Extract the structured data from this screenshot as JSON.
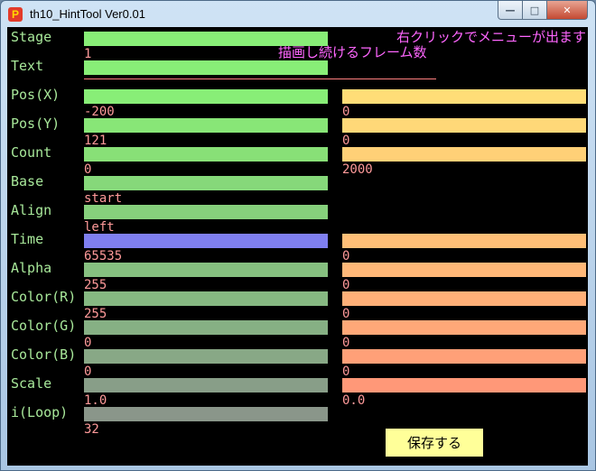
{
  "window": {
    "title": "th10_HintTool Ver0.01",
    "app_icon_letter": "P",
    "background_texts": [
      "",
      ""
    ]
  },
  "colors": {
    "label": "#a8e89a",
    "value": "#ff9a9a",
    "hint": "#ff66ff",
    "save_button_bg": "#ffff99"
  },
  "hint": {
    "line1": "右クリックでメニューが出ます",
    "line2": "描画し続けるフレーム数"
  },
  "rows": [
    {
      "label": "Stage",
      "left_value": "1",
      "right_value": "",
      "left_color": "#88ee77",
      "right_color": ""
    },
    {
      "label": "Text",
      "left_value": "",
      "right_value": "",
      "left_color": "#88ee77",
      "right_color": ""
    },
    {
      "label": "Pos(X)",
      "left_value": "-200",
      "right_value": "0",
      "left_color": "#88ee77",
      "right_color": "#ffdd77"
    },
    {
      "label": "Pos(Y)",
      "left_value": "121",
      "right_value": "0",
      "left_color": "#88e677",
      "right_color": "#ffd878"
    },
    {
      "label": "Count",
      "left_value": "0",
      "right_value": "2000",
      "left_color": "#88e077",
      "right_color": "#ffd077"
    },
    {
      "label": "Base",
      "left_value": "start",
      "right_value": "",
      "left_color": "#86d87a",
      "right_color": ""
    },
    {
      "label": "Align",
      "left_value": "left",
      "right_value": "",
      "left_color": "#86d07c",
      "right_color": ""
    },
    {
      "label": "Time",
      "left_value": "65535",
      "right_value": "0",
      "left_color": "#7f7ff0",
      "right_color": "#ffbf77"
    },
    {
      "label": "Alpha",
      "left_value": "255",
      "right_value": "0",
      "left_color": "#86c080",
      "right_color": "#ffb878"
    },
    {
      "label": "Color(R)",
      "left_value": "255",
      "right_value": "0",
      "left_color": "#86b882",
      "right_color": "#ffb078"
    },
    {
      "label": "Color(G)",
      "left_value": "0",
      "right_value": "0",
      "left_color": "#86b084",
      "right_color": "#ffa878"
    },
    {
      "label": "Color(B)",
      "left_value": "0",
      "right_value": "0",
      "left_color": "#88a886",
      "right_color": "#ffa078"
    },
    {
      "label": "Scale",
      "left_value": "1.0",
      "right_value": "0.0",
      "left_color": "#889e88",
      "right_color": "#ff9878"
    },
    {
      "label": "i(Loop)",
      "left_value": "32",
      "right_value": "",
      "left_color": "#8a968a",
      "right_color": ""
    }
  ],
  "save_button": {
    "label": "保存する"
  }
}
